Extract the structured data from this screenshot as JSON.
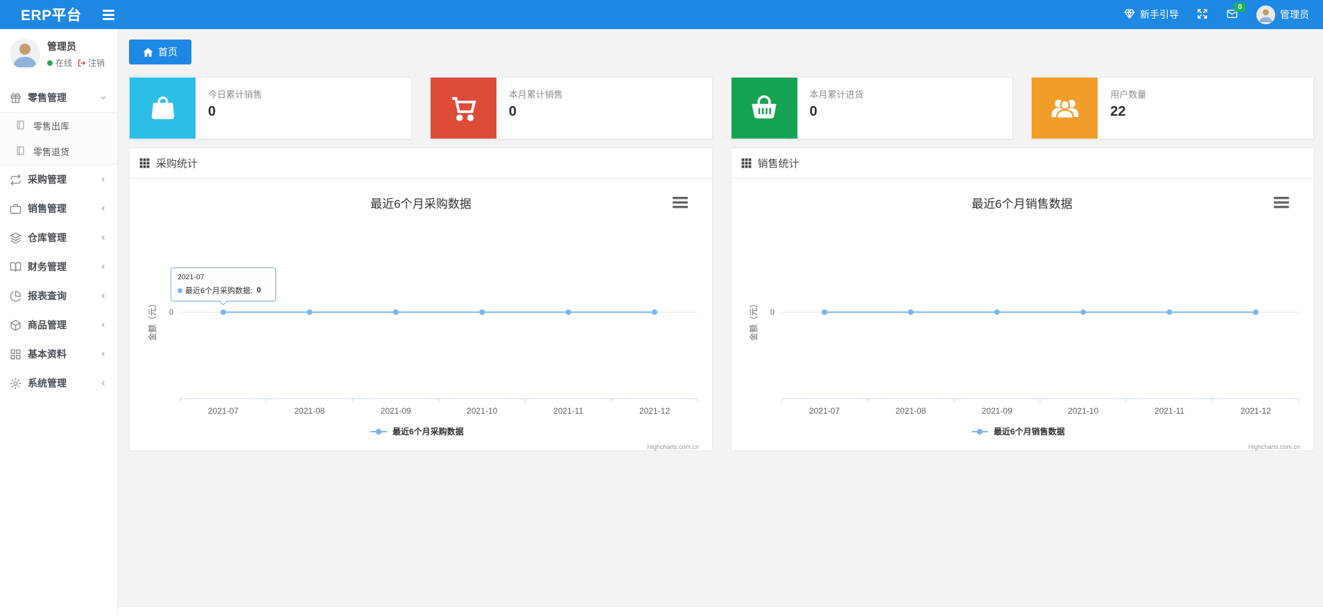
{
  "topbar": {
    "brand": "ERP平台",
    "guide_label": "新手引导",
    "mail_badge": "0",
    "username": "管理员"
  },
  "sidebar": {
    "user_name": "管理员",
    "status": "在线",
    "logout_label": "注销",
    "items": [
      {
        "label": "零售管理",
        "icon": "gift-icon",
        "expanded": true
      },
      {
        "label": "零售出库",
        "icon": "journal-icon",
        "child_of": "零售管理"
      },
      {
        "label": "零售退货",
        "icon": "journal-icon",
        "child_of": "零售管理"
      },
      {
        "label": "采购管理",
        "icon": "repeat-icon"
      },
      {
        "label": "销售管理",
        "icon": "briefcase-icon"
      },
      {
        "label": "仓库管理",
        "icon": "layers-icon"
      },
      {
        "label": "财务管理",
        "icon": "book-open-icon"
      },
      {
        "label": "报表查询",
        "icon": "pie-chart-icon"
      },
      {
        "label": "商品管理",
        "icon": "box-icon"
      },
      {
        "label": "基本资料",
        "icon": "grid-icon"
      },
      {
        "label": "系统管理",
        "icon": "gear-icon"
      }
    ]
  },
  "tab": {
    "home_label": "首页"
  },
  "cards": [
    {
      "title": "今日累计销售",
      "value": "0",
      "color": "#2bbfe8",
      "icon": "shopping-bag-icon"
    },
    {
      "title": "本月累计销售",
      "value": "0",
      "color": "#dd4b39",
      "icon": "shopping-cart-icon"
    },
    {
      "title": "本月累计进货",
      "value": "0",
      "color": "#16a353",
      "icon": "shopping-basket-icon"
    },
    {
      "title": "用户数量",
      "value": "22",
      "color": "#f09d29",
      "icon": "users-icon"
    }
  ],
  "panels": [
    {
      "title": "采购统计"
    },
    {
      "title": "销售统计"
    }
  ],
  "chart_data": [
    {
      "type": "line",
      "title": "最近6个月采购数据",
      "categories": [
        "2021-07",
        "2021-08",
        "2021-09",
        "2021-10",
        "2021-11",
        "2021-12"
      ],
      "series": [
        {
          "name": "最近6个月采购数据",
          "values": [
            0,
            0,
            0,
            0,
            0,
            0
          ]
        }
      ],
      "xlabel": "",
      "ylabel": "金额（元）",
      "ytick_label": "0",
      "ylim": [
        0,
        0
      ],
      "grid": true,
      "legend_position": "bottom",
      "color": "#7cb5ec",
      "credit": "Highcharts.com.cn",
      "tooltip": {
        "header": "2021-07",
        "label": "最近6个月采购数据:",
        "value": "0"
      }
    },
    {
      "type": "line",
      "title": "最近6个月销售数据",
      "categories": [
        "2021-07",
        "2021-08",
        "2021-09",
        "2021-10",
        "2021-11",
        "2021-12"
      ],
      "series": [
        {
          "name": "最近6个月销售数据",
          "values": [
            0,
            0,
            0,
            0,
            0,
            0
          ]
        }
      ],
      "xlabel": "",
      "ylabel": "金额（元）",
      "ytick_label": "0",
      "ylim": [
        0,
        0
      ],
      "grid": true,
      "legend_position": "bottom",
      "color": "#7cb5ec",
      "credit": "Highcharts.com.cn"
    }
  ]
}
